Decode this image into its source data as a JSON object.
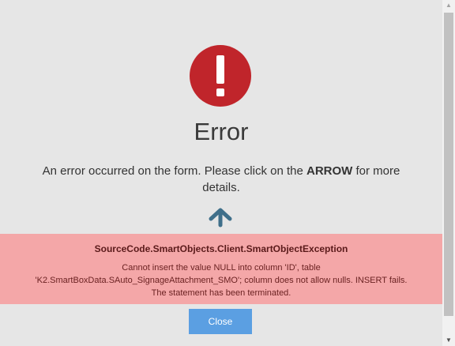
{
  "dialog": {
    "title": "Error",
    "message_prefix": "An error occurred on the form. Please click on the ",
    "message_emphasis": "ARROW",
    "message_suffix": " for more details.",
    "icon": "exclamation-circle-icon",
    "arrow_icon": "arrow-up-icon",
    "colors": {
      "background": "#e6e6e6",
      "icon_red": "#c0252b",
      "arrow": "#3f6f8a",
      "exception_bg": "#f4a7a8",
      "close_button": "#5b9fe2"
    }
  },
  "exception": {
    "type": "SourceCode.SmartObjects.Client.SmartObjectException",
    "line1": "Cannot insert the value NULL into column 'ID', table",
    "line2": "'K2.SmartBoxData.SAuto_SignageAttachment_SMO'; column does not allow nulls. INSERT fails.",
    "line3": "The statement has been terminated."
  },
  "actions": {
    "close_label": "Close"
  },
  "scrollbar": {
    "up_glyph": "▲",
    "down_glyph": "▼"
  }
}
